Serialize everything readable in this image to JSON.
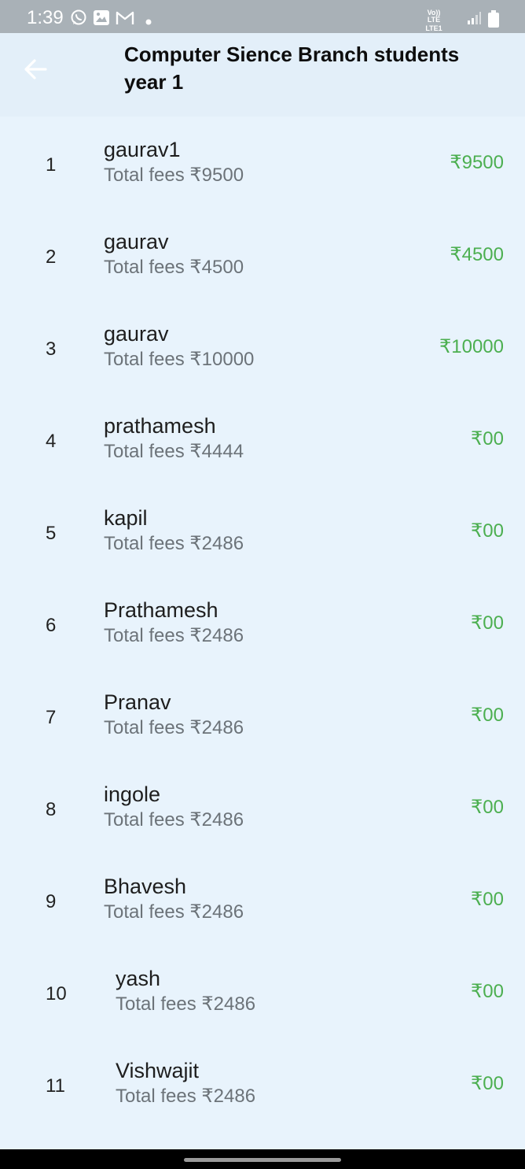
{
  "status_bar": {
    "time": "1:39",
    "network_top": "Vo)) LTE",
    "network_bottom": "LTE1",
    "icons": [
      "whatsapp-icon",
      "gallery-icon",
      "gmail-icon",
      "dot-icon",
      "signal-icon",
      "battery-icon"
    ]
  },
  "app_bar": {
    "back_icon": "arrow-left-icon",
    "title": "Computer Sience Branch students year 1"
  },
  "colors": {
    "background": "#e8f3fc",
    "app_bar": "#e3eff9",
    "amount_green": "#4caf50",
    "fees_gray": "#6c7379"
  },
  "students": [
    {
      "index": "1",
      "name": "gaurav1",
      "fees": "Total fees ₹9500",
      "amount": "₹9500"
    },
    {
      "index": "2",
      "name": "gaurav",
      "fees": "Total fees ₹4500",
      "amount": "₹4500"
    },
    {
      "index": "3",
      "name": "gaurav",
      "fees": "Total fees ₹10000",
      "amount": "₹10000"
    },
    {
      "index": "4",
      "name": "prathamesh",
      "fees": "Total fees ₹4444",
      "amount": "₹00"
    },
    {
      "index": "5",
      "name": "kapil",
      "fees": "Total fees ₹2486",
      "amount": "₹00"
    },
    {
      "index": "6",
      "name": "Prathamesh",
      "fees": "Total fees ₹2486",
      "amount": "₹00"
    },
    {
      "index": "7",
      "name": "Pranav",
      "fees": "Total fees ₹2486",
      "amount": "₹00"
    },
    {
      "index": "8",
      "name": "ingole",
      "fees": "Total fees ₹2486",
      "amount": "₹00"
    },
    {
      "index": "9",
      "name": "Bhavesh",
      "fees": "Total fees ₹2486",
      "amount": "₹00"
    },
    {
      "index": "10",
      "name": "yash",
      "fees": "Total fees ₹2486",
      "amount": "₹00"
    },
    {
      "index": "11",
      "name": "Vishwajit",
      "fees": "Total fees ₹2486",
      "amount": "₹00"
    }
  ]
}
